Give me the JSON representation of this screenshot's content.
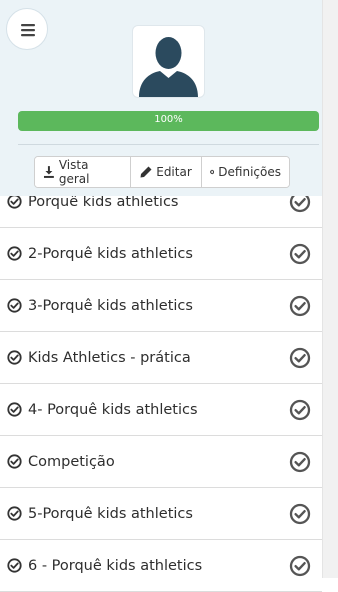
{
  "header": {
    "progress_value": 100,
    "progress_label": "100%",
    "buttons": {
      "overview": "Vista geral",
      "edit": "Editar",
      "settings": "Definições"
    }
  },
  "lessons": [
    {
      "title": "Porquê kids athletics",
      "completed": true
    },
    {
      "title": "2-Porquê kids athletics",
      "completed": true
    },
    {
      "title": "3-Porquê kids athletics",
      "completed": true
    },
    {
      "title": "Kids Athletics - prática",
      "completed": true
    },
    {
      "title": "4- Porquê kids athletics",
      "completed": true
    },
    {
      "title": "Competição",
      "completed": true
    },
    {
      "title": "5-Porquê kids athletics",
      "completed": true
    },
    {
      "title": "6 - Porquê kids athletics",
      "completed": true
    }
  ],
  "colors": {
    "progress": "#5cb85c",
    "avatar": "#2b4a5e",
    "header_bg": "#ebf3f7",
    "check": "#555555"
  },
  "icons": {
    "menu": "hamburger-icon",
    "overview": "download-icon",
    "edit": "pencil-icon",
    "settings": "gear-icon",
    "completed": "check-circle-icon"
  }
}
